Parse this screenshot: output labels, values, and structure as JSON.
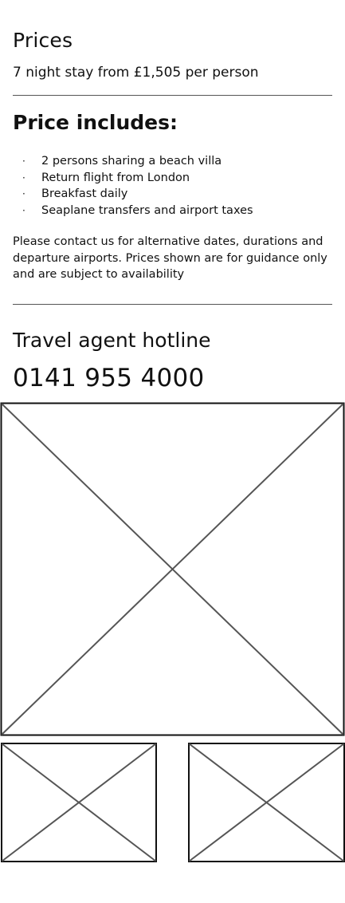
{
  "prices": {
    "heading": "Prices",
    "summary": "7 night stay from £1,505 per person"
  },
  "includes": {
    "heading": "Price includes:",
    "bullet": "·",
    "items": [
      "2 persons sharing a beach villa",
      "Return flight from London",
      "Breakfast daily",
      "Seaplane transfers and airport taxes"
    ]
  },
  "notice": "Please contact us for alternative dates, durations and departure airports. Prices shown are for guidance only and are subject to availability",
  "hotline": {
    "heading": "Travel agent hotline",
    "phone": "0141 955 4000"
  },
  "images": {
    "main_alt": "",
    "thumb_left_alt": "",
    "thumb_right_alt": ""
  }
}
